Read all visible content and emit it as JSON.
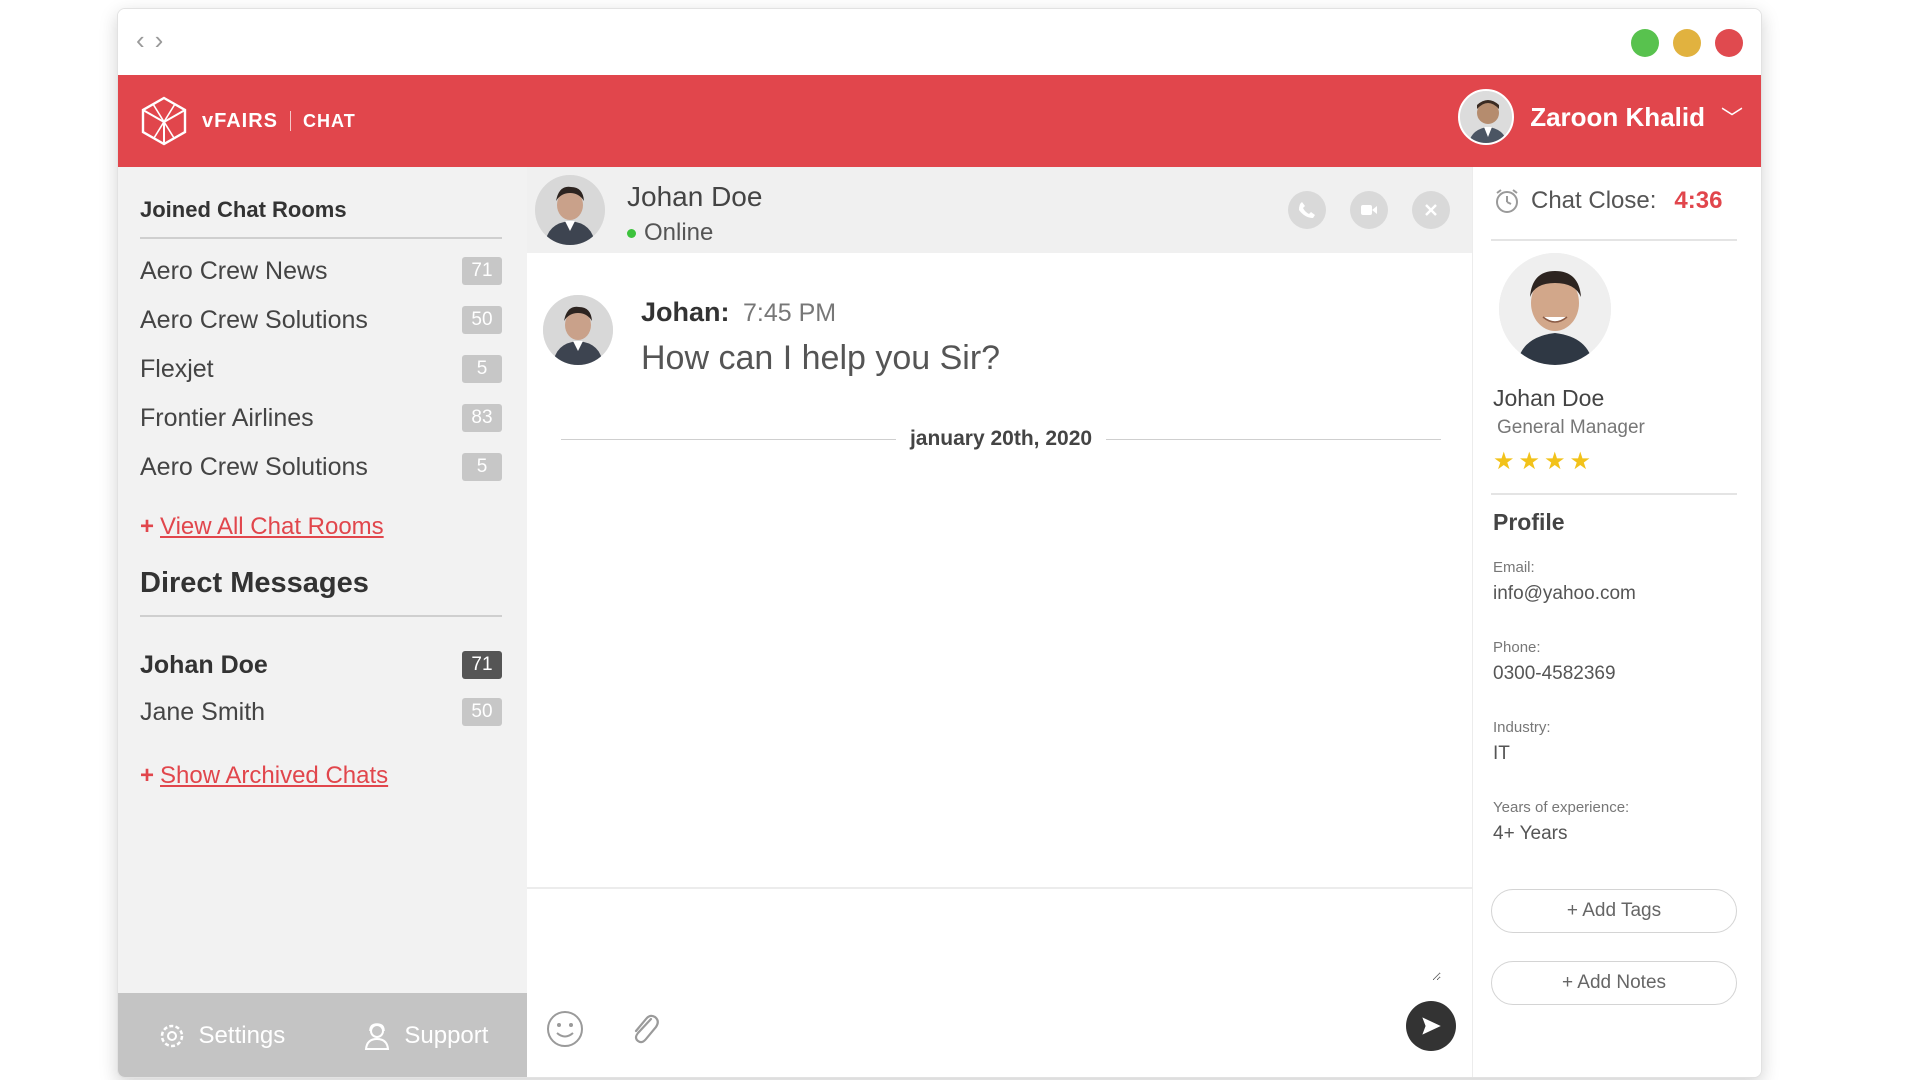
{
  "app": {
    "brand": "vFAIRS",
    "section": "CHAT",
    "colors": {
      "accent": "#e1464c",
      "sidebar_bg": "#f2f2f2",
      "online": "#3cc23c",
      "star": "#f2c21a"
    }
  },
  "user_menu": {
    "name": "Zaroon Khalid"
  },
  "sidebar": {
    "rooms_title": "Joined Chat Rooms",
    "rooms": [
      {
        "label": "Aero Crew News",
        "count": "71"
      },
      {
        "label": "Aero Crew Solutions",
        "count": "50"
      },
      {
        "label": "Flexjet",
        "count": "5"
      },
      {
        "label": "Frontier Airlines",
        "count": "83"
      },
      {
        "label": "Aero Crew Solutions",
        "count": "5"
      }
    ],
    "view_all_label": "View All Chat Rooms",
    "dm_title": "Direct Messages",
    "dms": [
      {
        "label": "Johan Doe",
        "count": "71"
      },
      {
        "label": "Jane Smith",
        "count": "50"
      }
    ],
    "archived_label": "Show Archived Chats",
    "footer": {
      "settings_label": "Settings",
      "support_label": "Support"
    }
  },
  "chat": {
    "contact_name": "Johan Doe",
    "contact_status": "Online",
    "message": {
      "sender": "Johan:",
      "time": "7:45 PM",
      "text": "How can I help you Sir?"
    },
    "date_separator": "january 20th, 2020",
    "composer_placeholder": ""
  },
  "profile": {
    "timer_label": "Chat Close:",
    "timer_value": "4:36",
    "name": "Johan Doe",
    "role": "General Manager",
    "rating": 4,
    "stars_text": "★★★★",
    "section_title": "Profile",
    "fields": [
      {
        "label": "Email:",
        "value": "info@yahoo.com"
      },
      {
        "label": "Phone:",
        "value": "0300-4582369"
      },
      {
        "label": "Industry:",
        "value": "IT"
      },
      {
        "label": "Years of experience:",
        "value": "4+ Years"
      }
    ],
    "add_tags_label": "+ Add Tags",
    "add_notes_label": "+ Add Notes"
  }
}
